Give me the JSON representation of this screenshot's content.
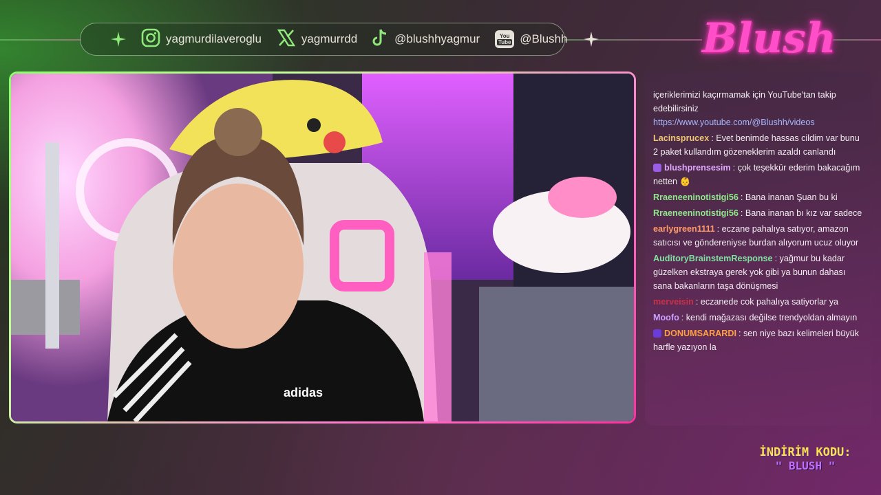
{
  "socials": [
    {
      "icon": "instagram-icon",
      "handle": "yagmurdilaveroglu"
    },
    {
      "icon": "x-icon",
      "handle": "yagmurrdd"
    },
    {
      "icon": "tiktok-icon",
      "handle": "@blushhyagmur"
    },
    {
      "icon": "youtube-icon",
      "handle": "@Blushh"
    }
  ],
  "youtube_badge": {
    "line1": "You",
    "line2": "Tube"
  },
  "logo": "Blush",
  "webcam": {
    "shirt_text": "adidas"
  },
  "chat": [
    {
      "user": "",
      "text": "içeriklerimizi kaçırmamak için YouTube'tan takip edebilirsiniz",
      "link": "https://www.youtube.com/@Blushh/videos",
      "color": "#ffffff"
    },
    {
      "user": "Lacinsprucex",
      "text": ": Evet benimde hassas cildim var bunu 2 paket kullandım gözeneklerim azaldı canlandı",
      "color": "#f0c870"
    },
    {
      "user": "blushprensesim",
      "text": ": çok teşekkür ederim bakacağım netten 👶",
      "color": "#e0a8ff",
      "badge": "#9b5de5"
    },
    {
      "user": "Rraeneeninotistigi56",
      "text": ": Bana inanan Şuan bu ki",
      "color": "#8fe88a"
    },
    {
      "user": "Rraeneeninotistigi56",
      "text": ": Bana inanan bı kız var sadece",
      "color": "#8fe88a"
    },
    {
      "user": "earlygreen1111",
      "text": ": eczane pahalıya satıyor, amazon satıcısı ve göndereniyse burdan alıyorum ucuz oluyor",
      "color": "#ff9a66"
    },
    {
      "user": "AuditoryBrainstemResponse",
      "text": ": yağmur bu kadar güzelken ekstraya gerek yok gibi ya bunun dahası sana bakanların taşa dönüşmesi",
      "color": "#7fe0a0"
    },
    {
      "user": "merveisin",
      "text": ": eczanede cok pahalıya satiyorlar ya",
      "color": "#c83048"
    },
    {
      "user": "Moofo",
      "text": ": kendi mağazası değilse trendyoldan almayın",
      "color": "#c8a0ff"
    },
    {
      "user": "DONUMSARARDI",
      "text": ": sen niye bazı kelimeleri büyük harfle yazıyon la",
      "color": "#ffa040",
      "badge": "#6a3dd8"
    }
  ],
  "discount": {
    "label": "İNDİRİM KODU:",
    "code": "\" BLUSH \""
  },
  "colors": {
    "accent_pink": "#ff4fc8",
    "accent_green": "#8cff6a",
    "discount_yellow": "#ffe14a"
  }
}
